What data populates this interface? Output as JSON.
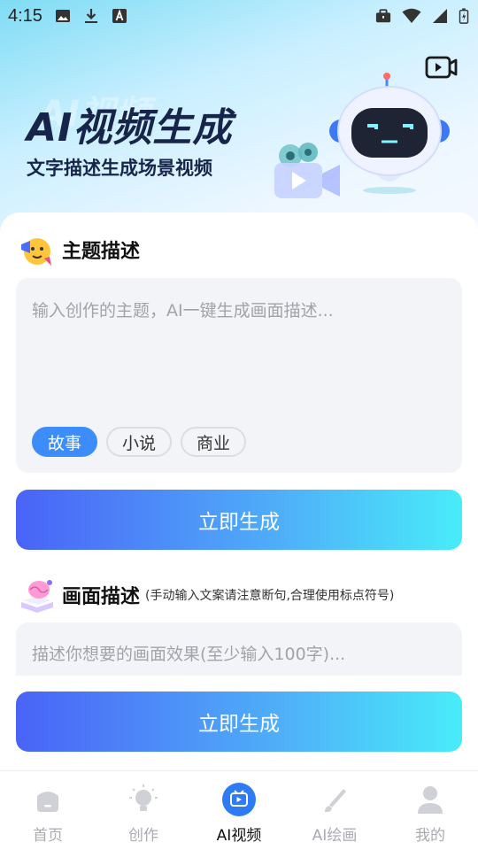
{
  "status_bar": {
    "time": "4:15",
    "left_icons": [
      "image-icon",
      "download-icon",
      "a-box-icon"
    ],
    "right_icons": [
      "briefcase-icon",
      "wifi-icon",
      "signal-icon",
      "battery-icon"
    ]
  },
  "hero": {
    "title": "AI视频生成",
    "subtitle": "文字描述生成场景视频",
    "shadow_text": "AI视频"
  },
  "theme_section": {
    "title": "主题描述",
    "input_placeholder": "输入创作的主题，AI一键生成画面描述...",
    "chips": [
      {
        "label": "故事",
        "active": true
      },
      {
        "label": "小说",
        "active": false
      },
      {
        "label": "商业",
        "active": false
      }
    ],
    "generate_label": "立即生成"
  },
  "scene_section": {
    "title": "画面描述",
    "note": "(手动输入文案请注意断句,合理使用标点符号)",
    "input_placeholder": "描述你想要的画面效果(至少输入100字)...",
    "generate_label": "立即生成"
  },
  "tab_bar": {
    "tabs": [
      {
        "label": "首页",
        "icon": "home-icon",
        "active": false
      },
      {
        "label": "创作",
        "icon": "lightbulb-icon",
        "active": false
      },
      {
        "label": "AI视频",
        "icon": "video-icon",
        "active": true
      },
      {
        "label": "AI绘画",
        "icon": "brush-icon",
        "active": false
      },
      {
        "label": "我的",
        "icon": "user-icon",
        "active": false
      }
    ]
  },
  "colors": {
    "accent": "#3c8dfa",
    "gradient_start": "#4a63f7",
    "gradient_end": "#48ecf9",
    "title_dark": "#17254a"
  }
}
